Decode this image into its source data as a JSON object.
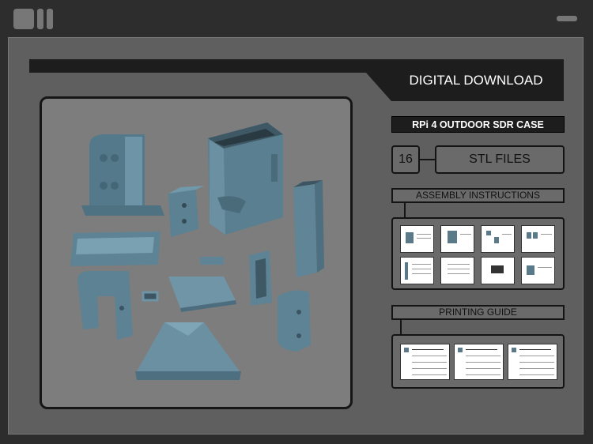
{
  "window": {
    "title": ""
  },
  "header": {
    "title": "DIGITAL DOWNLOAD"
  },
  "product": {
    "name": "RPi 4 OUTDOOR SDR CASE"
  },
  "stl": {
    "count": "16",
    "label": "STL FILES"
  },
  "sections": {
    "assembly": {
      "title": "ASSEMBLY INSTRUCTIONS",
      "page_count": 8
    },
    "printing": {
      "title": "PRINTING GUIDE",
      "page_count": 3
    }
  },
  "preview": {
    "content": "3D printed case parts render"
  },
  "colors": {
    "background": "#2d2d2d",
    "window": "#5f5f5f",
    "dark_bar": "#1d1d1d",
    "panel": "#6a6a6a",
    "part_color": "#5b7f90",
    "preview_bg": "#7d7d7d"
  }
}
